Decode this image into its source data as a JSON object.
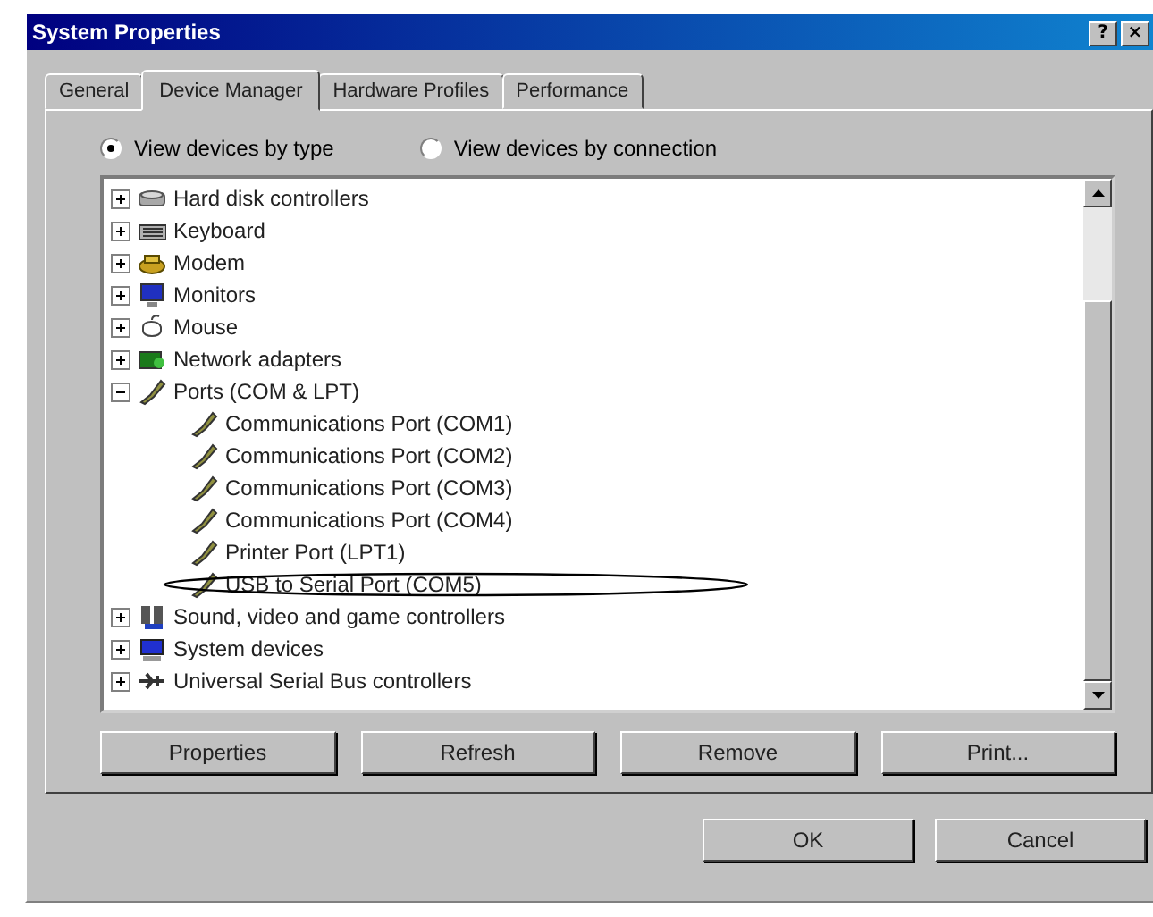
{
  "window": {
    "title": "System Properties",
    "title_buttons": [
      "?",
      "×"
    ]
  },
  "tabs": [
    {
      "label": "General",
      "selected": false
    },
    {
      "label": "Device Manager",
      "selected": true
    },
    {
      "label": "Hardware Profiles",
      "selected": false
    },
    {
      "label": "Performance",
      "selected": false
    }
  ],
  "view_options": [
    {
      "label": "View devices by type",
      "selected": true
    },
    {
      "label": "View devices by connection",
      "selected": false
    }
  ],
  "devices": [
    {
      "label": "Hard disk controllers",
      "kind": "disk",
      "expanded": false
    },
    {
      "label": "Keyboard",
      "kind": "keyboard",
      "expanded": false
    },
    {
      "label": "Modem",
      "kind": "modem",
      "expanded": false
    },
    {
      "label": "Monitors",
      "kind": "monitor",
      "expanded": false
    },
    {
      "label": "Mouse",
      "kind": "mouse",
      "expanded": false
    },
    {
      "label": "Network adapters",
      "kind": "network",
      "expanded": false
    },
    {
      "label": "Ports (COM & LPT)",
      "kind": "port",
      "expanded": true,
      "children": [
        {
          "label": "Communications Port (COM1)",
          "kind": "port",
          "circled": false
        },
        {
          "label": "Communications Port (COM2)",
          "kind": "port",
          "circled": false
        },
        {
          "label": "Communications Port (COM3)",
          "kind": "port",
          "circled": false
        },
        {
          "label": "Communications Port (COM4)",
          "kind": "port",
          "circled": false
        },
        {
          "label": "Printer Port (LPT1)",
          "kind": "port",
          "circled": false
        },
        {
          "label": "USB to Serial Port (COM5)",
          "kind": "port",
          "circled": true
        }
      ]
    },
    {
      "label": "Sound, video and game controllers",
      "kind": "sound",
      "expanded": false
    },
    {
      "label": "System devices",
      "kind": "system",
      "expanded": false
    },
    {
      "label": "Universal Serial Bus controllers",
      "kind": "usb",
      "expanded": false
    }
  ],
  "device_buttons": [
    "Properties",
    "Refresh",
    "Remove",
    "Print..."
  ],
  "dialog_buttons": [
    "OK",
    "Cancel"
  ]
}
